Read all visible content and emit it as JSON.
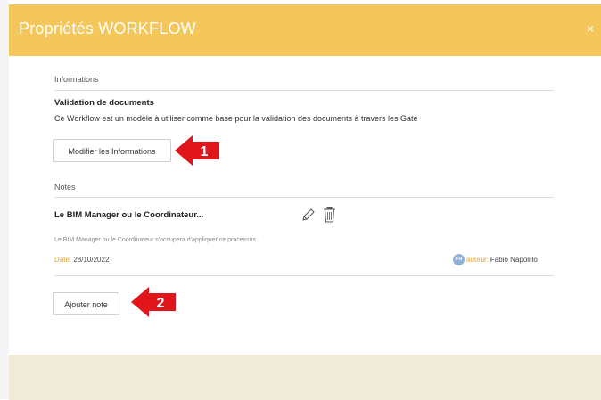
{
  "header": {
    "title": "Propriétés WORKFLOW",
    "close_label": "×"
  },
  "informations": {
    "section_label": "Informations",
    "title": "Validation de documents",
    "description": "Ce Workflow est un modèle à utiliser comme base pour la validation des documents à travers les Gate",
    "modify_button": "Modifier les Informations"
  },
  "notes": {
    "section_label": "Notes",
    "items": [
      {
        "title": "Le BIM Manager ou le Coordinateur...",
        "text": "Le BIM Manager ou le Coordinateur s'occupera d'appliquer ce processus.",
        "date_label": "Date:",
        "date": "28/10/2022",
        "author_label": "auteur:",
        "author": "Fabio Napolillo",
        "author_initials": "FN"
      }
    ],
    "add_button": "Ajouter note"
  },
  "annotations": {
    "arrow_1": "1",
    "arrow_2": "2",
    "color": "#e0161c"
  },
  "colors": {
    "header": "#f5c65a",
    "accent": "#e3a53c",
    "footer": "#efead9"
  }
}
